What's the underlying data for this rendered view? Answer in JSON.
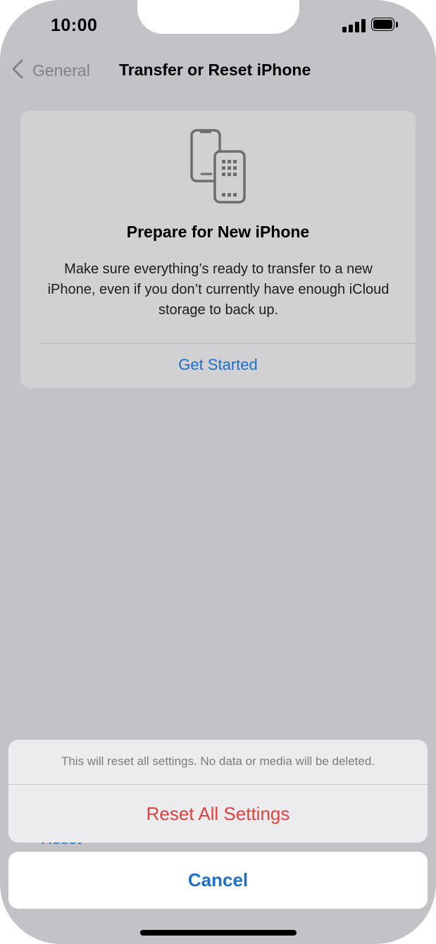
{
  "status_bar": {
    "time": "10:00",
    "signal_icon": "cellular-signal-icon",
    "battery_icon": "battery-full-icon"
  },
  "nav": {
    "back_icon": "chevron-left-icon",
    "back_label": "General",
    "title": "Transfer or Reset iPhone"
  },
  "prepare_card": {
    "icon": "two-iphones-icon",
    "title": "Prepare for New iPhone",
    "description": "Make sure everything’s ready to transfer to a new iPhone, even if you don’t currently have enough iCloud storage to back up.",
    "action_label": "Get Started"
  },
  "background_list": {
    "partial_item_label": "Reset"
  },
  "action_sheet": {
    "message": "This will reset all settings. No data or media will be deleted.",
    "destructive_label": "Reset All Settings",
    "cancel_label": "Cancel"
  },
  "colors": {
    "accent_blue": "#1d6fce",
    "destructive_red": "#e0413e",
    "dimmed_background": "#c3c2c7"
  }
}
